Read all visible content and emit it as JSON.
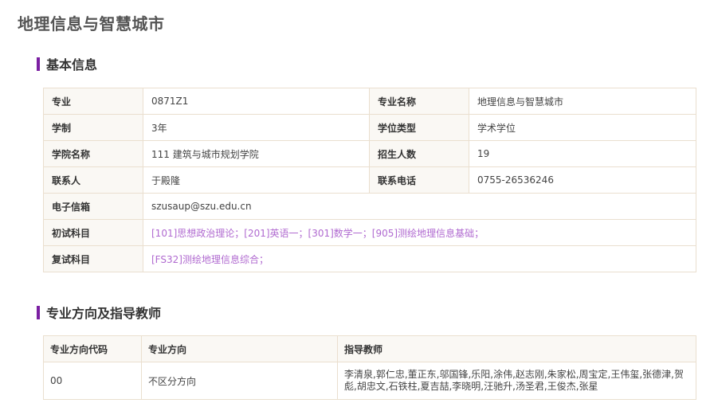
{
  "page": {
    "title": "地理信息与智慧城市"
  },
  "basic_info": {
    "heading": "基本信息",
    "rows": [
      [
        {
          "label": "专业",
          "value": "0871Z1"
        },
        {
          "label": "专业名称",
          "value": "地理信息与智慧城市"
        }
      ],
      [
        {
          "label": "学制",
          "value": "3年"
        },
        {
          "label": "学位类型",
          "value": "学术学位"
        }
      ],
      [
        {
          "label": "学院名称",
          "value": "111 建筑与城市规划学院"
        },
        {
          "label": "招生人数",
          "value": "19"
        }
      ],
      [
        {
          "label": "联系人",
          "value": "于殿隆"
        },
        {
          "label": "联系电话",
          "value": "0755-26536246"
        }
      ]
    ],
    "email": {
      "label": "电子信箱",
      "value": "szusaup@szu.edu.cn"
    },
    "initial_exam": {
      "label": "初试科目",
      "value": "[101]思想政治理论；[201]英语一；[301]数学一；[905]测绘地理信息基础；"
    },
    "retest": {
      "label": "复试科目",
      "value": "[FS32]测绘地理信息综合；"
    }
  },
  "directions": {
    "heading": "专业方向及指导教师",
    "columns": [
      "专业方向代码",
      "专业方向",
      "指导教师"
    ],
    "rows": [
      {
        "code": "00",
        "name": "不区分方向",
        "teachers": "李清泉,郭仁忠,董正东,邬国锋,乐阳,涂伟,赵志刚,朱家松,周宝定,王伟玺,张德津,贺彪,胡忠文,石铁柱,夏吉喆,李晓明,汪驰升,汤圣君,王俊杰,张星"
      }
    ]
  },
  "colors": {
    "accent": "#7b1fa2",
    "subject_text": "#b06ad0",
    "table_border": "#eadfcf",
    "label_bg": "#faf8f4"
  }
}
